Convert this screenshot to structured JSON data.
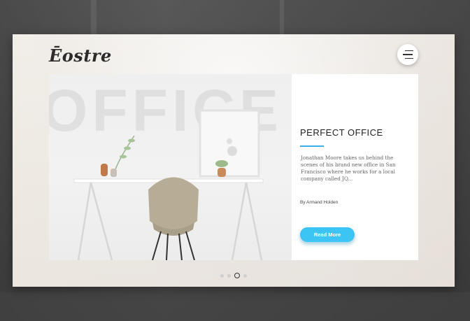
{
  "brand": {
    "logo_text": "Ēostre"
  },
  "header": {
    "menu_icon": "hamburger-menu-icon"
  },
  "slide": {
    "watermark_text": "OFFICE",
    "title": "PERFECT OFFICE",
    "description": "Jonathan Moore takes us behind the scenes of his brand new office in San Francisco where he works for a local company called JQ...",
    "byline": "By Armand Holden",
    "cta_label": "Read More",
    "accent_color": "#3bb0e8",
    "button_color": "#3cc4f5"
  },
  "pagination": {
    "total": 4,
    "active_index": 2
  }
}
